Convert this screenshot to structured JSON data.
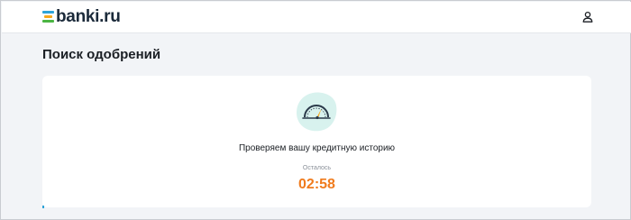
{
  "header": {
    "logo_text": "banki.ru",
    "profile_icon": "user-icon"
  },
  "main": {
    "title": "Поиск одобрений",
    "card": {
      "illustration_icon": "speedometer-icon",
      "status_text": "Проверяем вашу кредитную историю",
      "remaining_label": "Осталось",
      "timer": "02:58"
    }
  },
  "colors": {
    "timer": "#f07b1d",
    "logo_blue": "#2ea3d8",
    "logo_orange": "#f7a81b",
    "logo_green": "#4bb543",
    "illustration_bg": "#d8f2ee"
  }
}
